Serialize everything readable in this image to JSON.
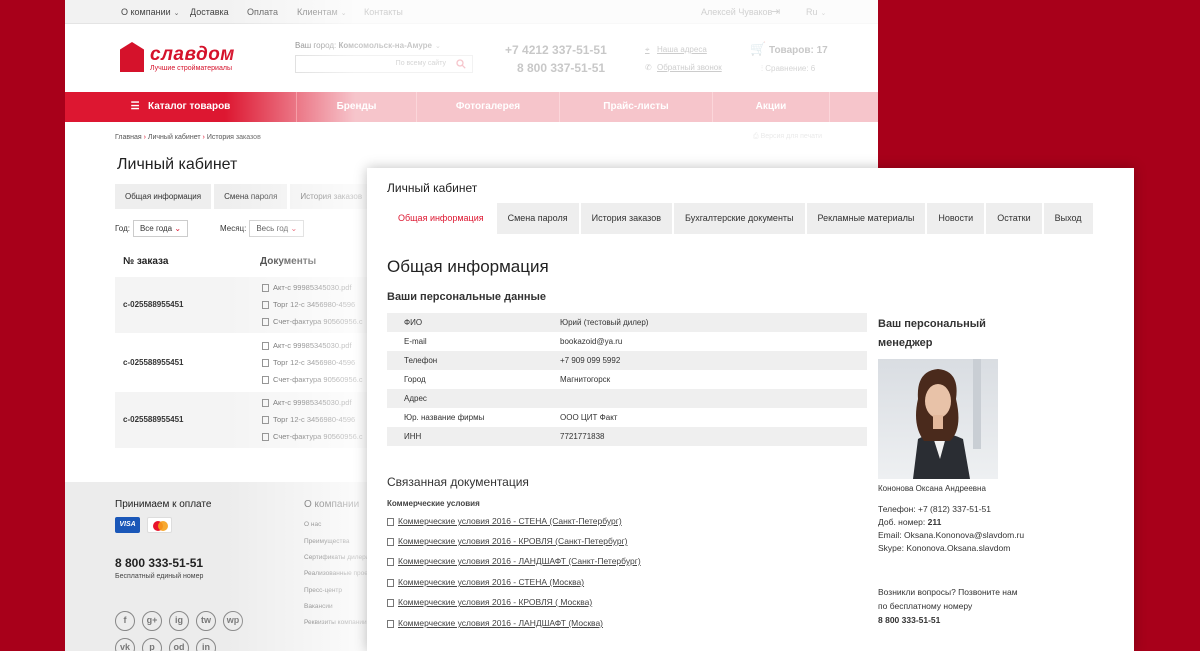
{
  "topbar": {
    "about": "О компании",
    "delivery": "Доставка",
    "payment": "Оплата",
    "clients": "Клиентам",
    "contacts": "Контакты",
    "user": "Алексей Чуваков",
    "lang": "Ru"
  },
  "header": {
    "logo_name": "славдом",
    "logo_tagline": "Лучшие стройматериалы",
    "city_label": "Ваш город:",
    "city": "Комсомольск-на-Амуре",
    "search_placeholder": "По всему сайту",
    "phone1": "+7 4212 337-51-51",
    "phone2": "8 800 337-51-51",
    "address_link": "Наша адреса",
    "callback_link": "Обратный звонок",
    "cart": "Товаров: 17",
    "compare": "Сравнение: 6"
  },
  "nav": {
    "catalog": "Каталог товаров",
    "brands": "Бренды",
    "gallery": "Фотогалерея",
    "prices": "Прайс-листы",
    "promos": "Акции"
  },
  "breadcrumb": {
    "home": "Главная",
    "cabinet": "Личный кабинет",
    "history": "История заказов"
  },
  "print": "Версия для печати",
  "back_page": {
    "title": "Личный кабинет",
    "tabs": [
      "Общая информация",
      "Смена пароля",
      "История заказов"
    ],
    "year_label": "Год:",
    "year_value": "Все года",
    "month_label": "Месяц:",
    "month_value": "Весь год",
    "col_order": "№ заказа",
    "col_docs": "Документы",
    "orders": [
      {
        "num": "с-025588955451",
        "docs": [
          "Акт-с 99985345030.pdf",
          "Торг 12-с 3456980-4596",
          "Счет-фактура 90560956.c"
        ]
      },
      {
        "num": "с-025588955451",
        "docs": [
          "Акт-с 99985345030.pdf",
          "Торг 12-с 3456980-4596",
          "Счет-фактура 90560956.c"
        ]
      },
      {
        "num": "с-025588955451",
        "docs": [
          "Акт-с 99985345030.pdf",
          "Торг 12-с 3456980-4596",
          "Счет-фактура 90560956.c"
        ]
      }
    ]
  },
  "footer": {
    "payment_title": "Принимаем к оплате",
    "card1": "VISA",
    "about_title": "О компании",
    "phone": "8 800 333-51-51",
    "phone_sub": "Бесплатный единый номер",
    "links": [
      "О нас",
      "Преимущества",
      "Сертификаты дилера",
      "Реализованные проекты",
      "Пресс-центр",
      "Вакансии",
      "Реквизиты компании"
    ],
    "social": [
      "f",
      "g+",
      "ig",
      "tw",
      "wp",
      "vk",
      "p",
      "od",
      "in"
    ]
  },
  "cabinet": {
    "title": "Личный кабинет",
    "tabs": [
      "Общая информация",
      "Смена пароля",
      "История заказов",
      "Бухгалтерские документы",
      "Рекламные материалы",
      "Новости",
      "Остатки",
      "Выход"
    ],
    "heading": "Общая информация",
    "personal_heading": "Ваши персональные данные",
    "personal": [
      {
        "k": "ФИО",
        "v": "Юрий (тестовый дилер)"
      },
      {
        "k": "E-mail",
        "v": "bookazoid@ya.ru"
      },
      {
        "k": "Телефон",
        "v": "+7 909 099 5992"
      },
      {
        "k": "Город",
        "v": "Магнитогорск"
      },
      {
        "k": "Адрес",
        "v": ""
      },
      {
        "k": "Юр. название фирмы",
        "v": "ООО ЦИТ Факт"
      },
      {
        "k": "ИНН",
        "v": "7721771838"
      }
    ],
    "docs_heading": "Связанная документация",
    "docs_sub": "Коммерческие условия",
    "docs": [
      "Коммерческие условия 2016 - СТЕНА (Санкт-Петербург)",
      "Коммерческие условия 2016 - КРОВЛЯ (Санкт-Петербург)",
      "Коммерческие условия 2016 - ЛАНДШАФТ (Санкт-Петербург)",
      "Коммерческие условия 2016 - СТЕНА (Москва)",
      "Коммерческие условия 2016 - КРОВЛЯ ( Москва)",
      "Коммерческие условия 2016 - ЛАНДШАФТ (Москва)"
    ],
    "manager_heading": "Ваш персональный менеджер",
    "manager_name": "Кононова Оксана Андреевна",
    "manager_phone": "Телефон: +7 (812) 337-51-51",
    "manager_ext_label": "Доб. номер:",
    "manager_ext": "211",
    "manager_email": "Email: Oksana.Kononova@slavdom.ru",
    "manager_skype": "Skype: Kononova.Oksana.slavdom",
    "question1": "Возникли вопросы? Позвоните нам",
    "question2": "по бесплатному номеру",
    "question_phone": "8 800 333-51-51"
  },
  "colors": {
    "brand": "#dd1731",
    "background": "#a8001a"
  }
}
